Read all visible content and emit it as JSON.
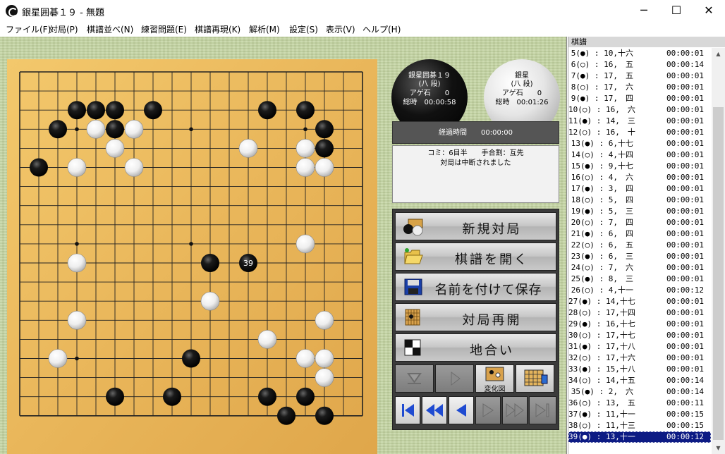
{
  "window": {
    "title": "銀星囲碁１９ - 無題",
    "minimize": "─",
    "maximize": "☐",
    "close": "✕"
  },
  "menu": [
    "ファイル(F)",
    "対局(P)",
    "棋譜並べ(N)",
    "練習問題(E)",
    "棋譜再現(K)",
    "解析(M)",
    "設定(S)",
    "表示(V)",
    "ヘルプ(H)"
  ],
  "black_player": {
    "name": "銀星囲碁１９",
    "rank": "(八 段)",
    "captures": "アゲ石　　0",
    "time": "総時　00:00:58"
  },
  "white_player": {
    "name": "銀星",
    "rank": "(八 段)",
    "captures": "アゲ石　　0",
    "time": "総時　00:01:26"
  },
  "elapsed": "経過時間　　00:00:00",
  "info": {
    "line1": "コミ：6目半　　手合割：互先",
    "line2": "対局は中断されました"
  },
  "buttons": {
    "new_game": "新規対局",
    "open_kifu": "棋譜を開く",
    "save_as": "名前を付けて保存",
    "resume": "対局再開",
    "territory": "地合い",
    "variation": "変化図"
  },
  "board": {
    "size": 19,
    "last_move_number": "39",
    "black": [
      [
        3,
        2
      ],
      [
        4,
        2
      ],
      [
        5,
        2
      ],
      [
        7,
        2
      ],
      [
        13,
        2
      ],
      [
        15,
        2
      ],
      [
        2,
        3
      ],
      [
        5,
        3
      ],
      [
        16,
        3
      ],
      [
        16,
        4
      ],
      [
        1,
        5
      ],
      [
        10,
        10
      ],
      [
        9,
        15
      ],
      [
        5,
        17
      ],
      [
        8,
        17
      ],
      [
        13,
        17
      ],
      [
        15,
        17
      ],
      [
        14,
        18
      ],
      [
        16,
        18
      ],
      [
        12,
        10
      ]
    ],
    "white": [
      [
        4,
        3
      ],
      [
        6,
        3
      ],
      [
        5,
        4
      ],
      [
        12,
        4
      ],
      [
        15,
        4
      ],
      [
        3,
        5
      ],
      [
        6,
        5
      ],
      [
        15,
        5
      ],
      [
        16,
        5
      ],
      [
        15,
        9
      ],
      [
        3,
        10
      ],
      [
        10,
        12
      ],
      [
        3,
        13
      ],
      [
        16,
        13
      ],
      [
        13,
        14
      ],
      [
        2,
        15
      ],
      [
        15,
        15
      ],
      [
        16,
        15
      ],
      [
        16,
        16
      ]
    ],
    "last_move": [
      12,
      10
    ]
  },
  "kifu": {
    "header": "棋譜",
    "rows": [
      {
        "move": "5(●)",
        "coord": "10,十六",
        "time": "00:00:01"
      },
      {
        "move": "6(○)",
        "coord": "16,　五",
        "time": "00:00:14"
      },
      {
        "move": "7(●)",
        "coord": "17,　五",
        "time": "00:00:01"
      },
      {
        "move": "8(○)",
        "coord": "17,　六",
        "time": "00:00:01"
      },
      {
        "move": "9(●)",
        "coord": "17,　四",
        "time": "00:00:01"
      },
      {
        "move": "10(○)",
        "coord": "16,　六",
        "time": "00:00:01"
      },
      {
        "move": "11(●)",
        "coord": "14,　三",
        "time": "00:00:01"
      },
      {
        "move": "12(○)",
        "coord": "16,　十",
        "time": "00:00:01"
      },
      {
        "move": "13(●)",
        "coord": "6,十七",
        "time": "00:00:01"
      },
      {
        "move": "14(○)",
        "coord": "4,十四",
        "time": "00:00:01"
      },
      {
        "move": "15(●)",
        "coord": "9,十七",
        "time": "00:00:01"
      },
      {
        "move": "16(○)",
        "coord": "4,　六",
        "time": "00:00:01"
      },
      {
        "move": "17(●)",
        "coord": "3,　四",
        "time": "00:00:01"
      },
      {
        "move": "18(○)",
        "coord": "5,　四",
        "time": "00:00:01"
      },
      {
        "move": "19(●)",
        "coord": "5,　三",
        "time": "00:00:01"
      },
      {
        "move": "20(○)",
        "coord": "7,　四",
        "time": "00:00:01"
      },
      {
        "move": "21(●)",
        "coord": "6,　四",
        "time": "00:00:01"
      },
      {
        "move": "22(○)",
        "coord": "6,　五",
        "time": "00:00:01"
      },
      {
        "move": "23(●)",
        "coord": "6,　三",
        "time": "00:00:01"
      },
      {
        "move": "24(○)",
        "coord": "7,　六",
        "time": "00:00:01"
      },
      {
        "move": "25(●)",
        "coord": "8,　三",
        "time": "00:00:01"
      },
      {
        "move": "26(○)",
        "coord": "4,十一",
        "time": "00:00:12"
      },
      {
        "move": "27(●)",
        "coord": "14,十七",
        "time": "00:00:01"
      },
      {
        "move": "28(○)",
        "coord": "17,十四",
        "time": "00:00:01"
      },
      {
        "move": "29(●)",
        "coord": "16,十七",
        "time": "00:00:01"
      },
      {
        "move": "30(○)",
        "coord": "17,十七",
        "time": "00:00:01"
      },
      {
        "move": "31(●)",
        "coord": "17,十八",
        "time": "00:00:01"
      },
      {
        "move": "32(○)",
        "coord": "17,十六",
        "time": "00:00:01"
      },
      {
        "move": "33(●)",
        "coord": "15,十八",
        "time": "00:00:01"
      },
      {
        "move": "34(○)",
        "coord": "14,十五",
        "time": "00:00:14"
      },
      {
        "move": "35(●)",
        "coord": "2,　六",
        "time": "00:00:14"
      },
      {
        "move": "36(○)",
        "coord": "13,　五",
        "time": "00:00:11"
      },
      {
        "move": "37(●)",
        "coord": "11,十一",
        "time": "00:00:15"
      },
      {
        "move": "38(○)",
        "coord": "11,十三",
        "time": "00:00:15"
      },
      {
        "move": "39(●)",
        "coord": "13,十一",
        "time": "00:00:12",
        "selected": true
      }
    ]
  },
  "colors": {
    "board": "#e9b65a",
    "selection": "#0d1b84",
    "tatami": "#c3d4a1"
  }
}
